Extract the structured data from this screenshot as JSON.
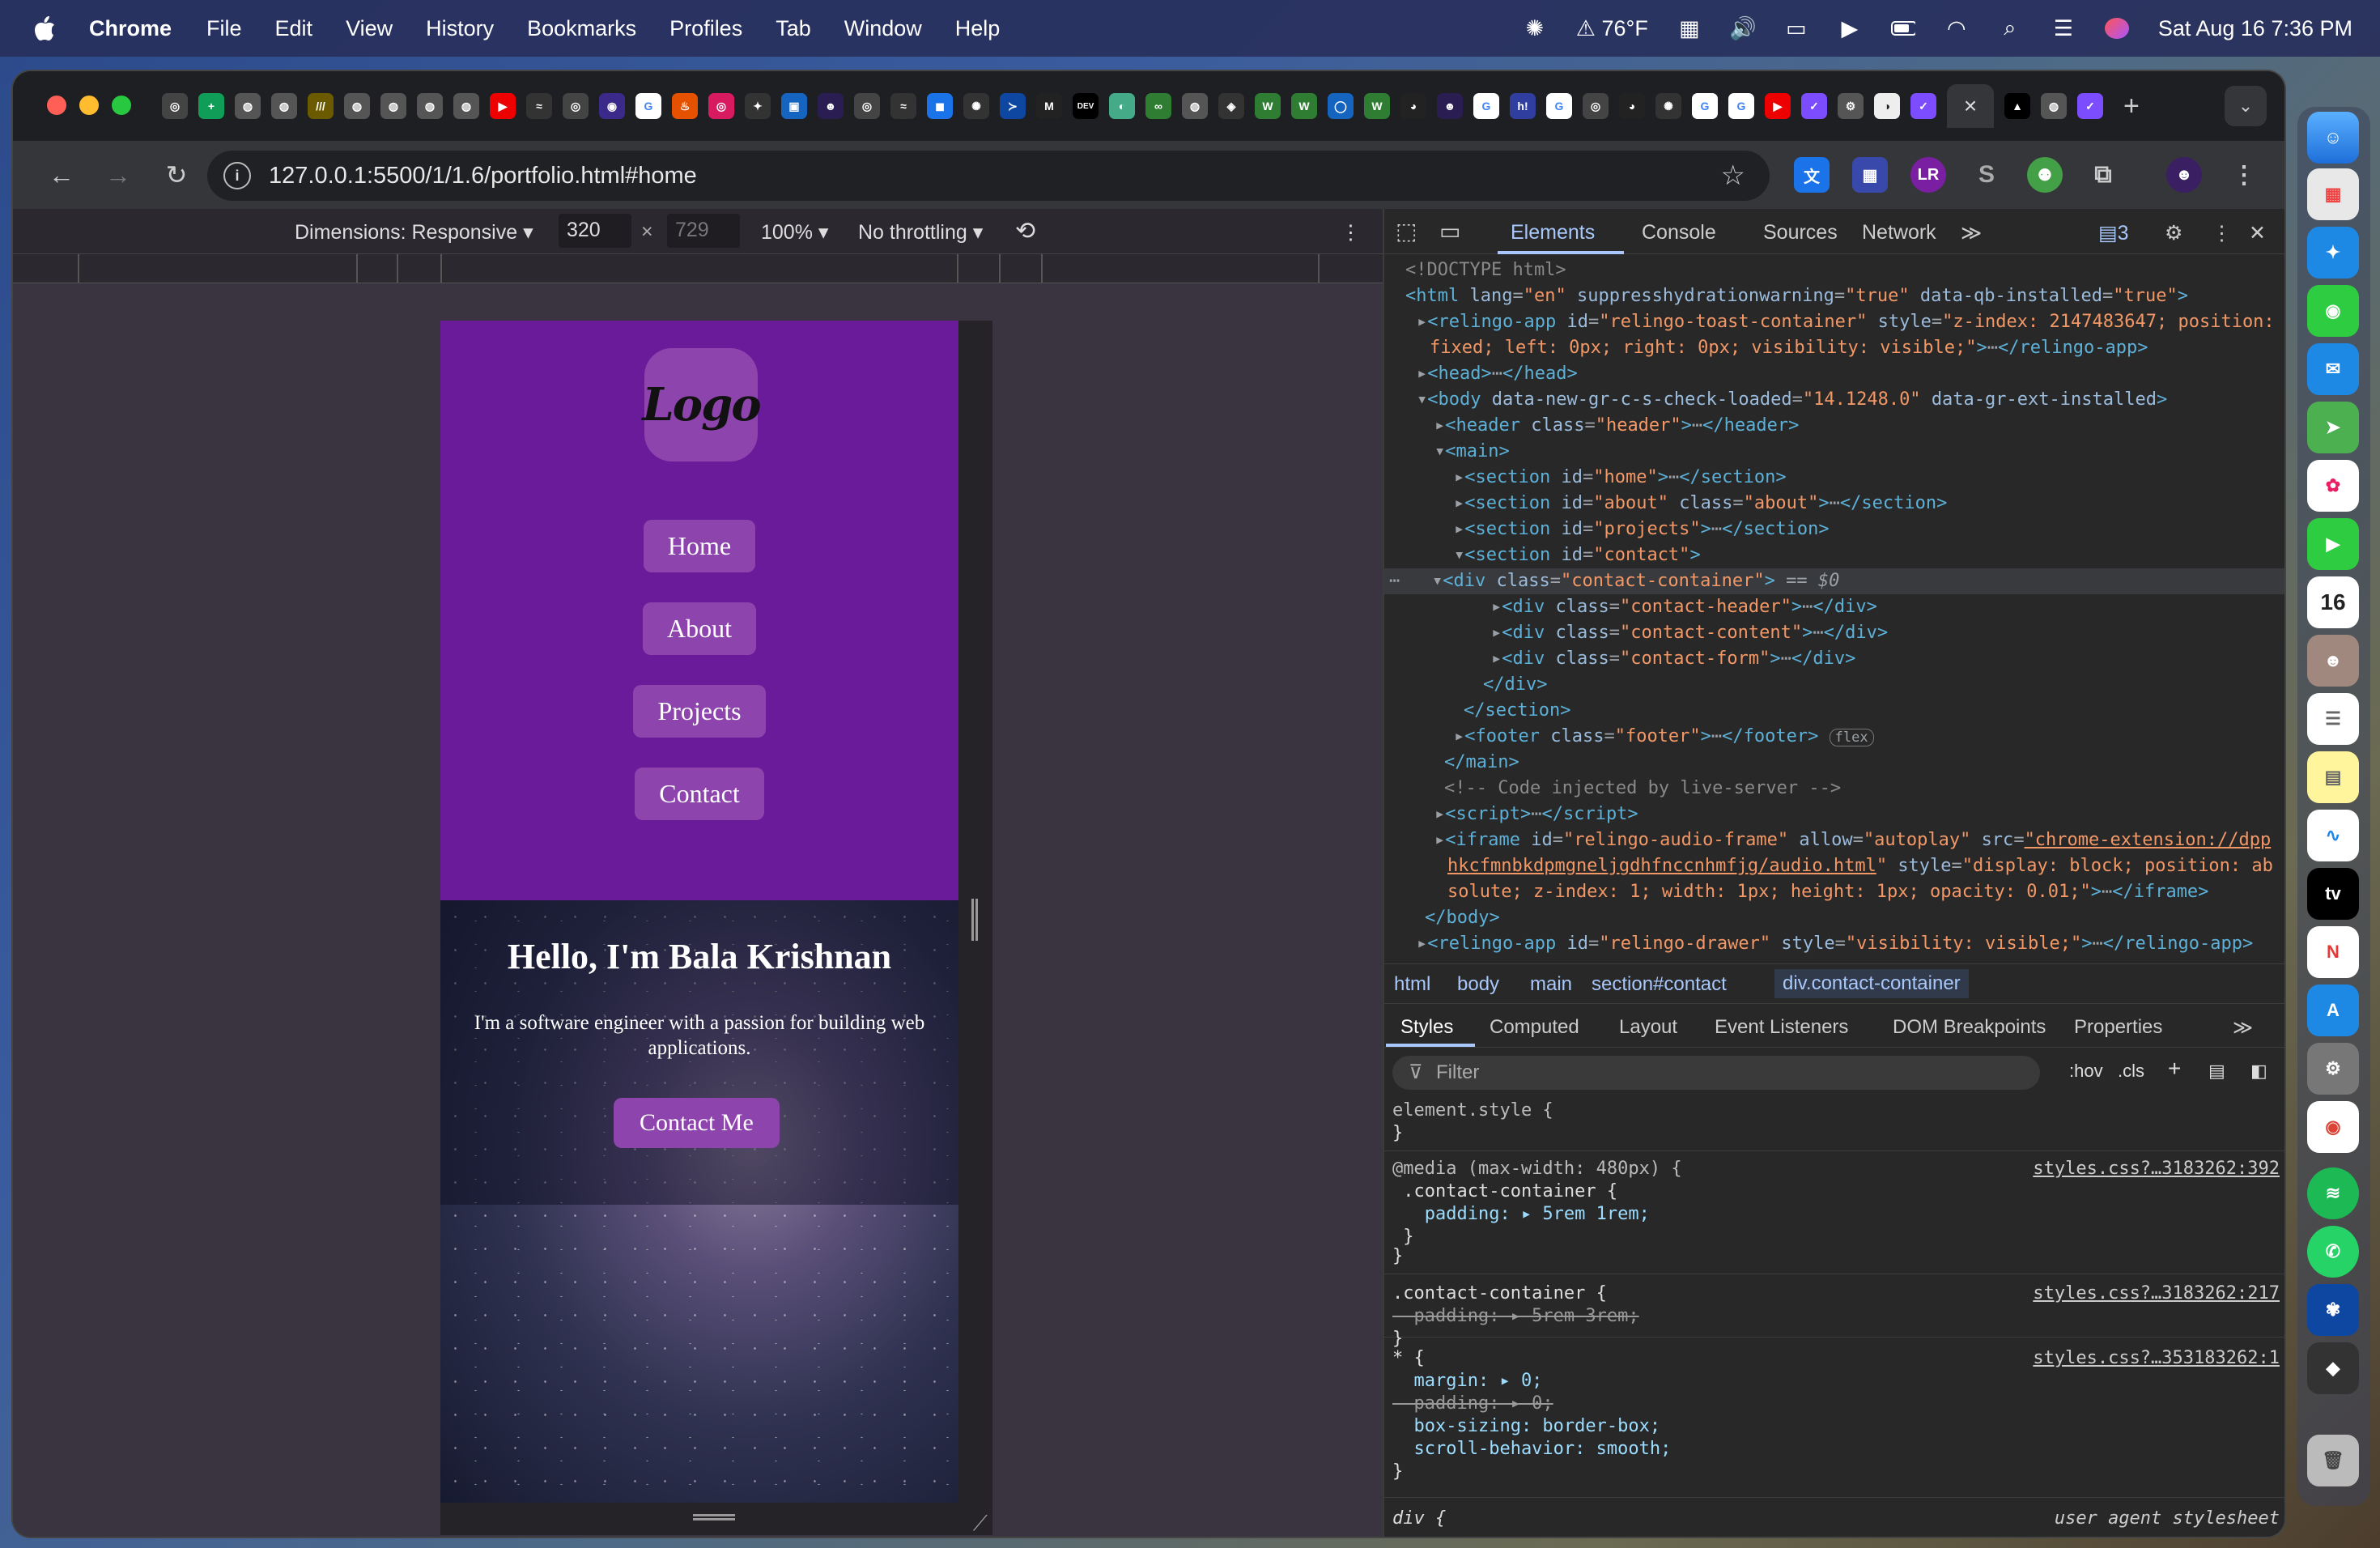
{
  "menubar": {
    "app": "Chrome",
    "items": [
      "File",
      "Edit",
      "View",
      "History",
      "Bookmarks",
      "Profiles",
      "Tab",
      "Window",
      "Help"
    ],
    "weather": "76°F",
    "datetime": "Sat Aug 16  7:36 PM"
  },
  "browser": {
    "url": "127.0.0.1:5500/1/1.6/portfolio.html#home",
    "tab_close": "×",
    "new_tab": "+"
  },
  "device_toolbar": {
    "dimensions": "Dimensions: Responsive ▾",
    "width": "320",
    "times": "×",
    "height": "729",
    "zoom": "100% ▾",
    "throttle": "No throttling ▾"
  },
  "page": {
    "logo": "Logo",
    "nav": [
      "Home",
      "About",
      "Projects",
      "Contact"
    ],
    "hero_title": "Hello, I'm Bala Krishnan",
    "hero_text": "I'm a software engineer with a passion for building web applications.",
    "cta": "Contact Me"
  },
  "devtools": {
    "tabs": [
      "Elements",
      "Console",
      "Sources",
      "Network"
    ],
    "issues": "3",
    "breadcrumbs": [
      "html",
      "body",
      "main",
      "section#contact",
      "div.contact-container"
    ],
    "styles_tabs": [
      "Styles",
      "Computed",
      "Layout",
      "Event Listeners",
      "DOM Breakpoints",
      "Properties"
    ],
    "filter": "Filter",
    "hov": ":hov",
    "cls": ".cls",
    "rules": {
      "r1_sel": "element.style {",
      "r1_end": "}",
      "r2_media": "@media (max-width: 480px) {",
      "r2_sel": " .contact-container {",
      "r2_prop": "   padding: ▸ 5rem 1rem;",
      "r2_end": " }",
      "r2_end2": "}",
      "r2_src": "styles.css?…3183262:392",
      "r3_sel": ".contact-container {",
      "r3_prop": "  padding: ▸ 5rem 3rem;",
      "r3_end": "}",
      "r3_src": "styles.css?…3183262:217",
      "r4_sel": "* {",
      "r4_p1": "  margin: ▸ 0;",
      "r4_p2": "  padding: ▸ 0;",
      "r4_p3": "  box-sizing: border-box;",
      "r4_p4": "  scroll-behavior: smooth;",
      "r4_end": "}",
      "r4_src": "styles.css?…353183262:1",
      "r5_sel": "div {",
      "r5_src": "user agent stylesheet"
    }
  }
}
